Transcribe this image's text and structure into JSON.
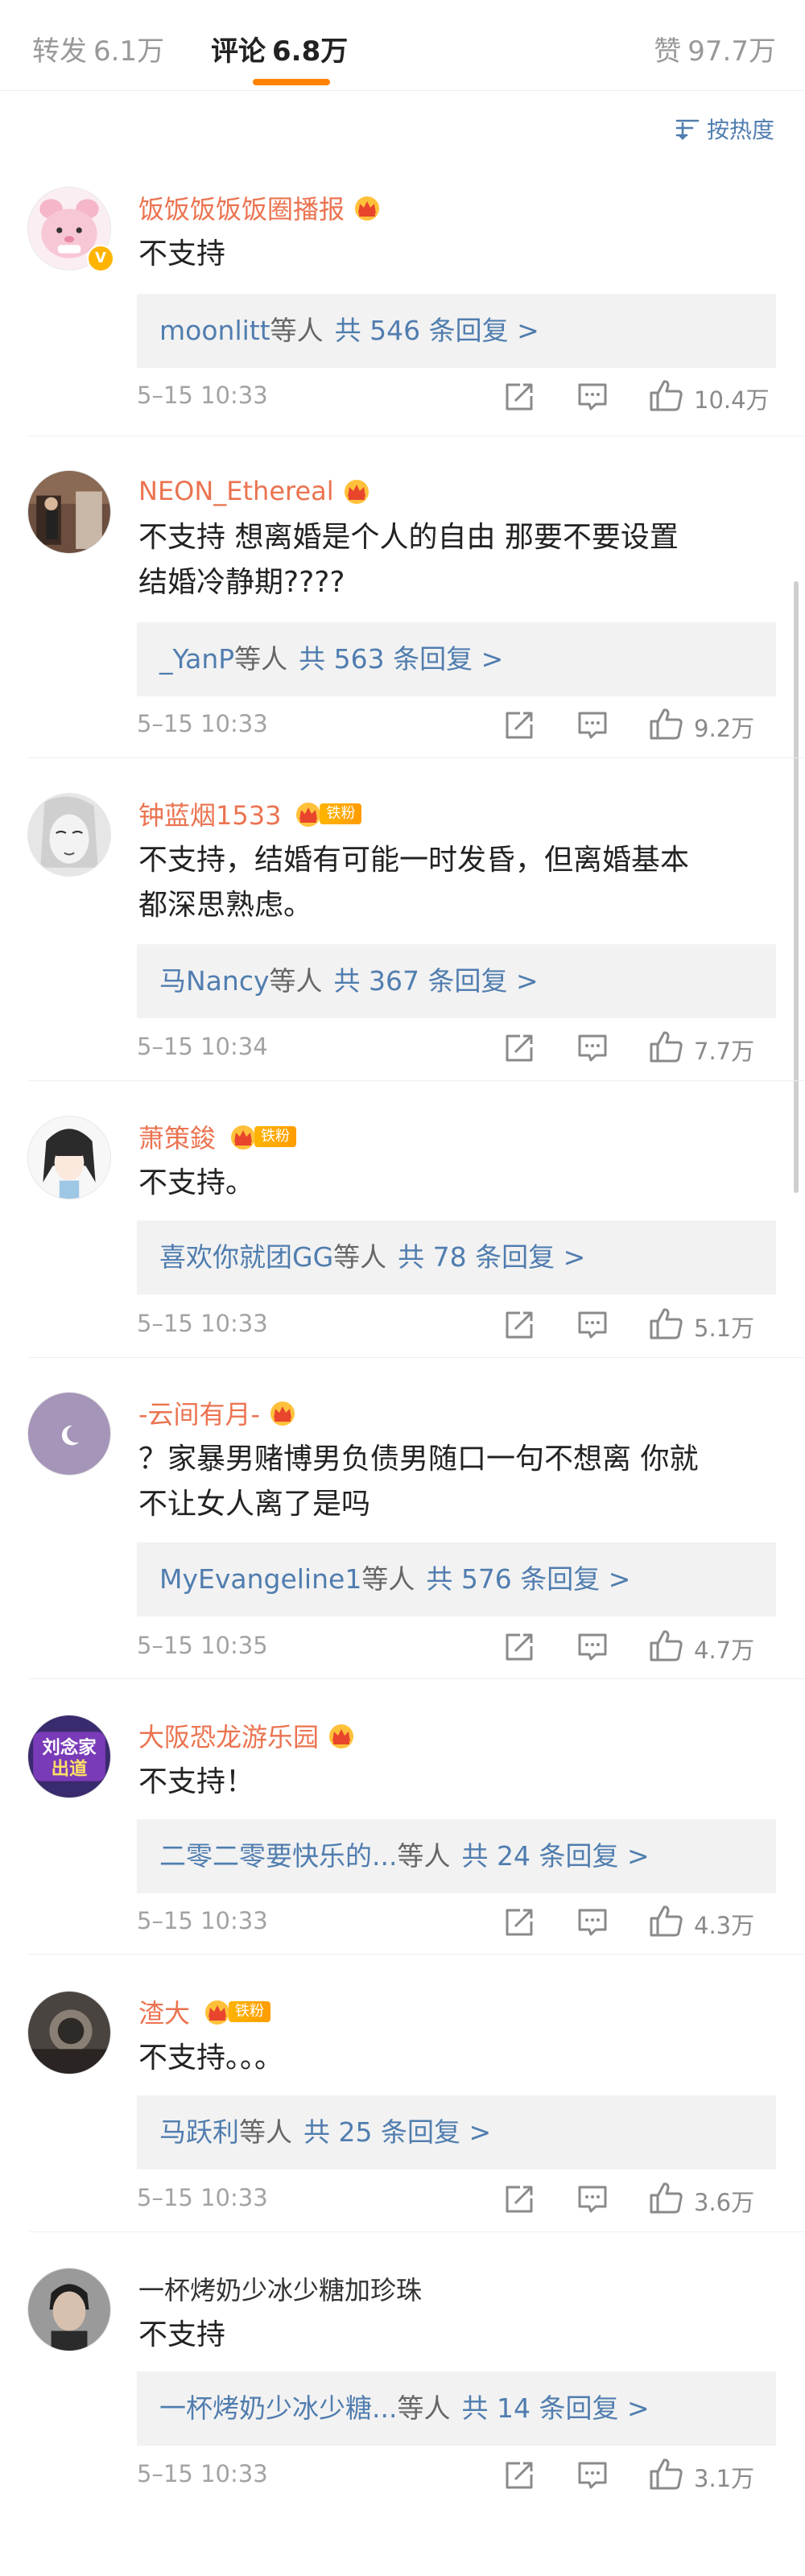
{
  "tabs": {
    "repost_label": "转发",
    "repost_count": "6.1万",
    "comment_label": "评论",
    "comment_count": "6.8万",
    "like_label": "赞",
    "like_count": "97.7万"
  },
  "sort_label": "按热度",
  "colors": {
    "accent": "#ff8200",
    "link": "#507daf",
    "username": "#eb7350",
    "reply_bg": "#f2f2f2"
  },
  "reply_suffix": "等人",
  "comments": [
    {
      "user": "饭饭饭饭饭圈播报",
      "avatar_icon": "pink-character-avatar",
      "verified": true,
      "crown": true,
      "fan_badge": "",
      "text": "不支持",
      "reply_names": "moonlitt",
      "reply_count": "共 546 条回复 >",
      "time": "5–15 10:33",
      "likes": "10.4万"
    },
    {
      "user": "NEON_Ethereal",
      "avatar_icon": "photo-avatar",
      "verified": false,
      "crown": true,
      "fan_badge": "",
      "text": "不支持 想离婚是个人的自由 那要不要设置\n结婚冷静期????",
      "reply_names": "_YanP",
      "reply_count": "共 563 条回复 >",
      "time": "5–15 10:33",
      "likes": "9.2万"
    },
    {
      "user": "钟蓝烟1533",
      "avatar_icon": "sketch-face-avatar",
      "verified": false,
      "crown": true,
      "fan_badge": "铁粉",
      "text": "不支持，结婚有可能一时发昏，但离婚基本\n都深思熟虑。",
      "reply_names": "马Nancy",
      "reply_count": "共 367 条回复 >",
      "time": "5–15 10:34",
      "likes": "7.7万"
    },
    {
      "user": "萧策鋑",
      "avatar_icon": "anime-character-avatar",
      "verified": false,
      "crown": true,
      "fan_badge": "铁粉",
      "text": "不支持。",
      "reply_names": "喜欢你就团GG",
      "reply_count": "共 78 条回复 >",
      "time": "5–15 10:33",
      "likes": "5.1万"
    },
    {
      "user": "-云间有月-",
      "avatar_icon": "moon-avatar",
      "verified": false,
      "crown": true,
      "fan_badge": "",
      "text": "？家暴男赌博男负债男随口一句不想离 你就\n不让女人离了是吗",
      "reply_names": "MyEvangeline1",
      "reply_count": "共 576 条回复 >",
      "time": "5–15 10:35",
      "likes": "4.7万"
    },
    {
      "user": "大阪恐龙游乐园",
      "avatar_icon": "text-logo-avatar",
      "avatar_text": "刘念家\n出道",
      "verified": false,
      "crown": true,
      "fan_badge": "",
      "text": "不支持！",
      "reply_names": "二零二零要快乐的...",
      "reply_count": "共 24 条回复 >",
      "time": "5–15 10:33",
      "likes": "4.3万"
    },
    {
      "user": "渣大",
      "avatar_icon": "dark-photo-avatar",
      "verified": false,
      "crown": true,
      "fan_badge": "铁粉",
      "text": "不支持。。。",
      "reply_names": "马跃利",
      "reply_count": "共 25 条回复 >",
      "time": "5–15 10:33",
      "likes": "3.6万"
    },
    {
      "user": "一杯烤奶少冰少糖加珍珠",
      "avatar_icon": "portrait-avatar",
      "verified": false,
      "crown": false,
      "fan_badge": "",
      "text": "不支持",
      "reply_names": "一杯烤奶少冰少糖...",
      "reply_count": "共 14 条回复 >",
      "time": "5–15 10:33",
      "likes": "3.1万"
    }
  ]
}
